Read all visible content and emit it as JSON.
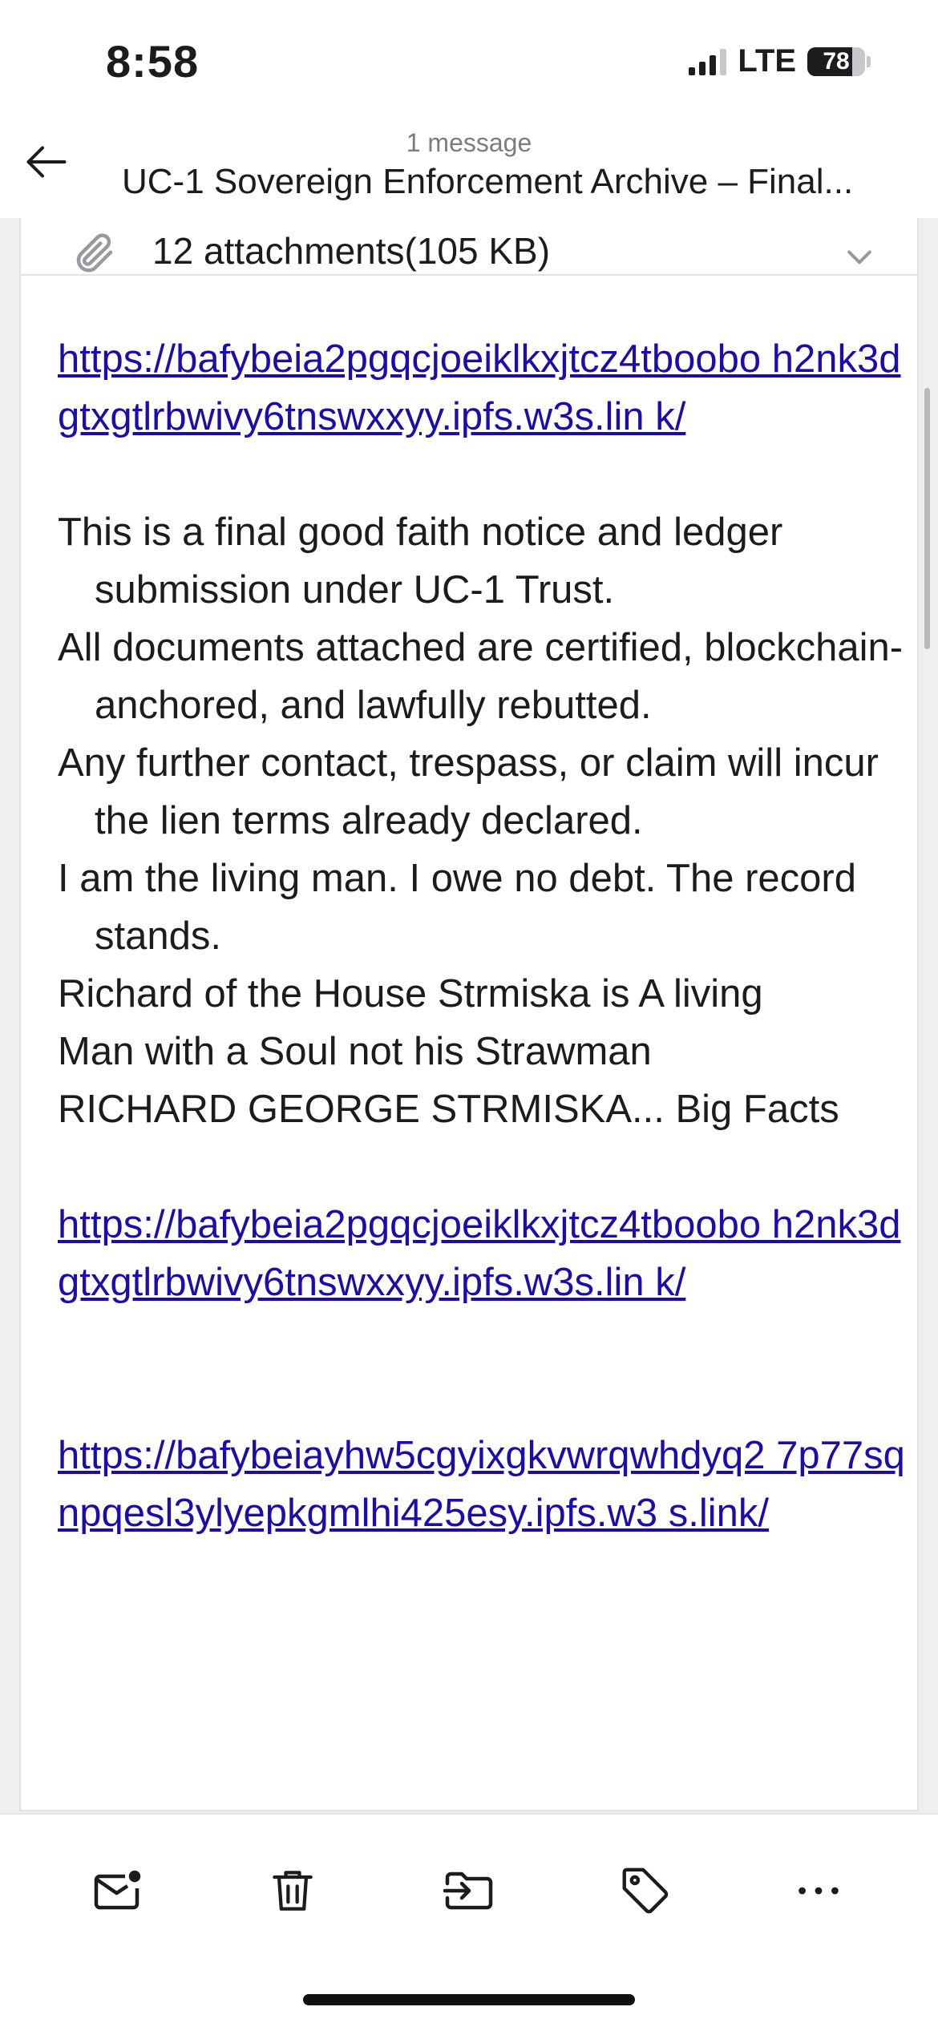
{
  "status_bar": {
    "time": "8:58",
    "network": "LTE",
    "battery": "78",
    "battery_level": 0.78
  },
  "header": {
    "subtitle": "1 message",
    "title": "UC-1 Sovereign Enforcement Archive – Final..."
  },
  "attachments": {
    "label": "12 attachments(105 KB)"
  },
  "message": {
    "link_1": "https://bafybeia2pgqcjoeiklkxjtcz4tboobo h2nk3dgtxgtlrbwivy6tnswxxyy.ipfs.w3s.lin k/",
    "paragraphs": [
      "This is a final good faith notice and ledger submission under UC-1 Trust.",
      "All documents attached are certified, blockchain-anchored, and lawfully rebutted.",
      "Any further contact, trespass, or claim will incur the lien terms already declared.",
      "I am the living man. I owe no debt. The record stands."
    ],
    "closing_lines": [
      "Richard of the House Strmiska is A living",
      "Man with a Soul not his Strawman",
      "RICHARD GEORGE STRMISKA... Big Facts"
    ],
    "link_2": "https://bafybeia2pgqcjoeiklkxjtcz4tboobo h2nk3dgtxgtlrbwivy6tnswxxyy.ipfs.w3s.lin k/",
    "link_3": "https://bafybeiayhw5cgyixgkvwrqwhdyq2 7p77sqnpqesl3ylyepkgmlhi425esy.ipfs.w3 s.link/"
  },
  "toolbar": {
    "icons": [
      "mark-unread-icon",
      "trash-icon",
      "move-icon",
      "tag-icon",
      "more-icon"
    ]
  }
}
